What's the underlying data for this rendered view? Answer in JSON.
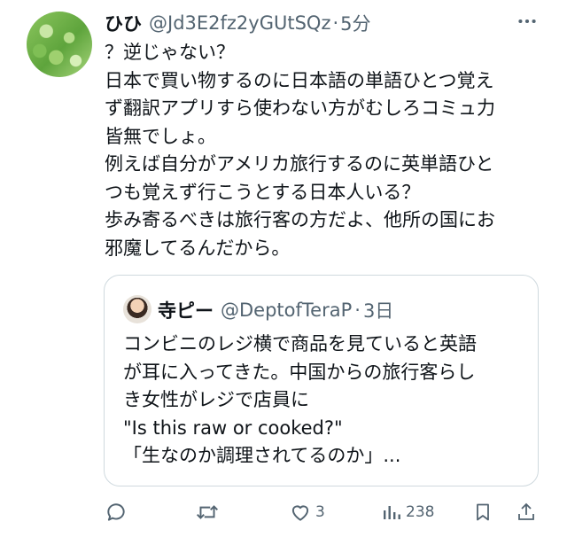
{
  "tweet": {
    "display_name": "ひひ",
    "handle": "@Jd3E2fz2yGUtSQz",
    "separator": "·",
    "time": "5分",
    "lines": [
      "？逆じゃない？",
      "日本で買い物するのに日本語の単語ひとつ覚え",
      "ず翻訳アプリすら使わない方がむしろコミュ力",
      "皆無でしょ。",
      "例えば自分がアメリカ旅行するのに英単語ひと",
      "つも覚えず行こうとする日本人いる？",
      "歩み寄るべきは旅行客の方だよ、他所の国にお",
      "邪魔してるんだから。"
    ]
  },
  "quote": {
    "display_name": "寺ピー",
    "handle": "@DeptofTeraP",
    "separator": "·",
    "time": "3日",
    "lines": [
      "コンビニのレジ横で商品を見ていると英語",
      "が耳に入ってきた。中国からの旅行客らし",
      "き女性がレジで店員に",
      "\"Is this raw or cooked?\"",
      "「生なのか調理されてるのか」..."
    ]
  },
  "actions": {
    "reply_count": "",
    "retweet_count": "",
    "like_count": "3",
    "views_count": "238"
  },
  "icons": [
    "more-icon",
    "reply-icon",
    "retweet-icon",
    "like-icon",
    "views-icon",
    "bookmark-icon",
    "share-icon"
  ],
  "colors": {
    "text": "#0f1419",
    "secondary": "#536471",
    "border": "#cfd9de"
  }
}
